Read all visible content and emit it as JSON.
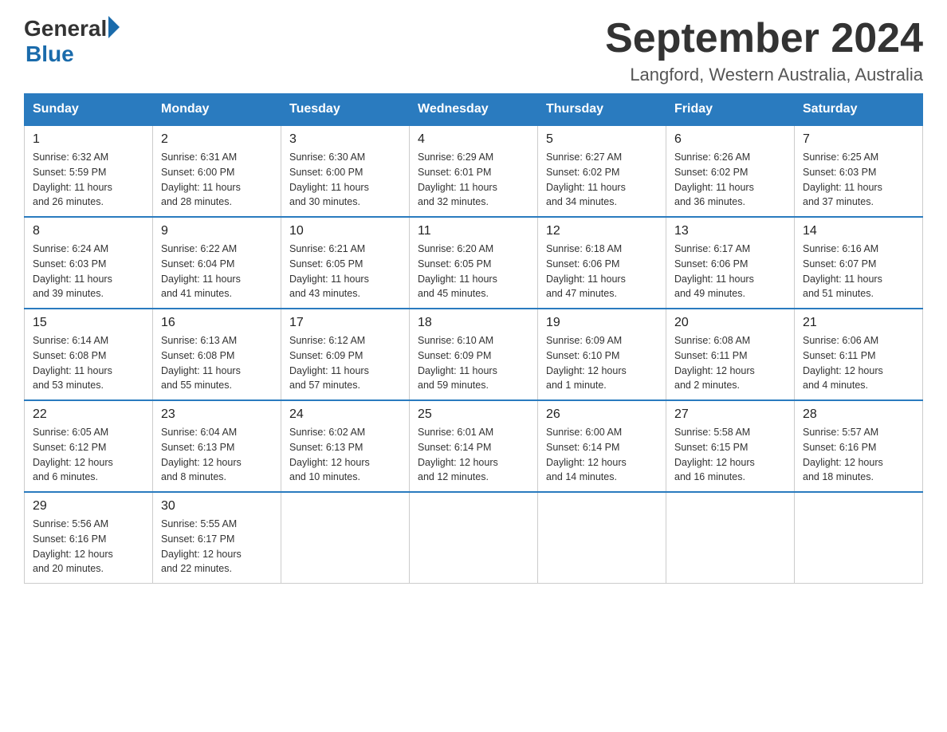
{
  "header": {
    "title": "September 2024",
    "subtitle": "Langford, Western Australia, Australia"
  },
  "logo": {
    "line1": "General",
    "line2": "Blue"
  },
  "days_of_week": [
    "Sunday",
    "Monday",
    "Tuesday",
    "Wednesday",
    "Thursday",
    "Friday",
    "Saturday"
  ],
  "weeks": [
    [
      {
        "day": "1",
        "sunrise": "6:32 AM",
        "sunset": "5:59 PM",
        "daylight": "11 hours and 26 minutes."
      },
      {
        "day": "2",
        "sunrise": "6:31 AM",
        "sunset": "6:00 PM",
        "daylight": "11 hours and 28 minutes."
      },
      {
        "day": "3",
        "sunrise": "6:30 AM",
        "sunset": "6:00 PM",
        "daylight": "11 hours and 30 minutes."
      },
      {
        "day": "4",
        "sunrise": "6:29 AM",
        "sunset": "6:01 PM",
        "daylight": "11 hours and 32 minutes."
      },
      {
        "day": "5",
        "sunrise": "6:27 AM",
        "sunset": "6:02 PM",
        "daylight": "11 hours and 34 minutes."
      },
      {
        "day": "6",
        "sunrise": "6:26 AM",
        "sunset": "6:02 PM",
        "daylight": "11 hours and 36 minutes."
      },
      {
        "day": "7",
        "sunrise": "6:25 AM",
        "sunset": "6:03 PM",
        "daylight": "11 hours and 37 minutes."
      }
    ],
    [
      {
        "day": "8",
        "sunrise": "6:24 AM",
        "sunset": "6:03 PM",
        "daylight": "11 hours and 39 minutes."
      },
      {
        "day": "9",
        "sunrise": "6:22 AM",
        "sunset": "6:04 PM",
        "daylight": "11 hours and 41 minutes."
      },
      {
        "day": "10",
        "sunrise": "6:21 AM",
        "sunset": "6:05 PM",
        "daylight": "11 hours and 43 minutes."
      },
      {
        "day": "11",
        "sunrise": "6:20 AM",
        "sunset": "6:05 PM",
        "daylight": "11 hours and 45 minutes."
      },
      {
        "day": "12",
        "sunrise": "6:18 AM",
        "sunset": "6:06 PM",
        "daylight": "11 hours and 47 minutes."
      },
      {
        "day": "13",
        "sunrise": "6:17 AM",
        "sunset": "6:06 PM",
        "daylight": "11 hours and 49 minutes."
      },
      {
        "day": "14",
        "sunrise": "6:16 AM",
        "sunset": "6:07 PM",
        "daylight": "11 hours and 51 minutes."
      }
    ],
    [
      {
        "day": "15",
        "sunrise": "6:14 AM",
        "sunset": "6:08 PM",
        "daylight": "11 hours and 53 minutes."
      },
      {
        "day": "16",
        "sunrise": "6:13 AM",
        "sunset": "6:08 PM",
        "daylight": "11 hours and 55 minutes."
      },
      {
        "day": "17",
        "sunrise": "6:12 AM",
        "sunset": "6:09 PM",
        "daylight": "11 hours and 57 minutes."
      },
      {
        "day": "18",
        "sunrise": "6:10 AM",
        "sunset": "6:09 PM",
        "daylight": "11 hours and 59 minutes."
      },
      {
        "day": "19",
        "sunrise": "6:09 AM",
        "sunset": "6:10 PM",
        "daylight": "12 hours and 1 minute."
      },
      {
        "day": "20",
        "sunrise": "6:08 AM",
        "sunset": "6:11 PM",
        "daylight": "12 hours and 2 minutes."
      },
      {
        "day": "21",
        "sunrise": "6:06 AM",
        "sunset": "6:11 PM",
        "daylight": "12 hours and 4 minutes."
      }
    ],
    [
      {
        "day": "22",
        "sunrise": "6:05 AM",
        "sunset": "6:12 PM",
        "daylight": "12 hours and 6 minutes."
      },
      {
        "day": "23",
        "sunrise": "6:04 AM",
        "sunset": "6:13 PM",
        "daylight": "12 hours and 8 minutes."
      },
      {
        "day": "24",
        "sunrise": "6:02 AM",
        "sunset": "6:13 PM",
        "daylight": "12 hours and 10 minutes."
      },
      {
        "day": "25",
        "sunrise": "6:01 AM",
        "sunset": "6:14 PM",
        "daylight": "12 hours and 12 minutes."
      },
      {
        "day": "26",
        "sunrise": "6:00 AM",
        "sunset": "6:14 PM",
        "daylight": "12 hours and 14 minutes."
      },
      {
        "day": "27",
        "sunrise": "5:58 AM",
        "sunset": "6:15 PM",
        "daylight": "12 hours and 16 minutes."
      },
      {
        "day": "28",
        "sunrise": "5:57 AM",
        "sunset": "6:16 PM",
        "daylight": "12 hours and 18 minutes."
      }
    ],
    [
      {
        "day": "29",
        "sunrise": "5:56 AM",
        "sunset": "6:16 PM",
        "daylight": "12 hours and 20 minutes."
      },
      {
        "day": "30",
        "sunrise": "5:55 AM",
        "sunset": "6:17 PM",
        "daylight": "12 hours and 22 minutes."
      },
      null,
      null,
      null,
      null,
      null
    ]
  ],
  "labels": {
    "sunrise": "Sunrise:",
    "sunset": "Sunset:",
    "daylight": "Daylight:"
  }
}
